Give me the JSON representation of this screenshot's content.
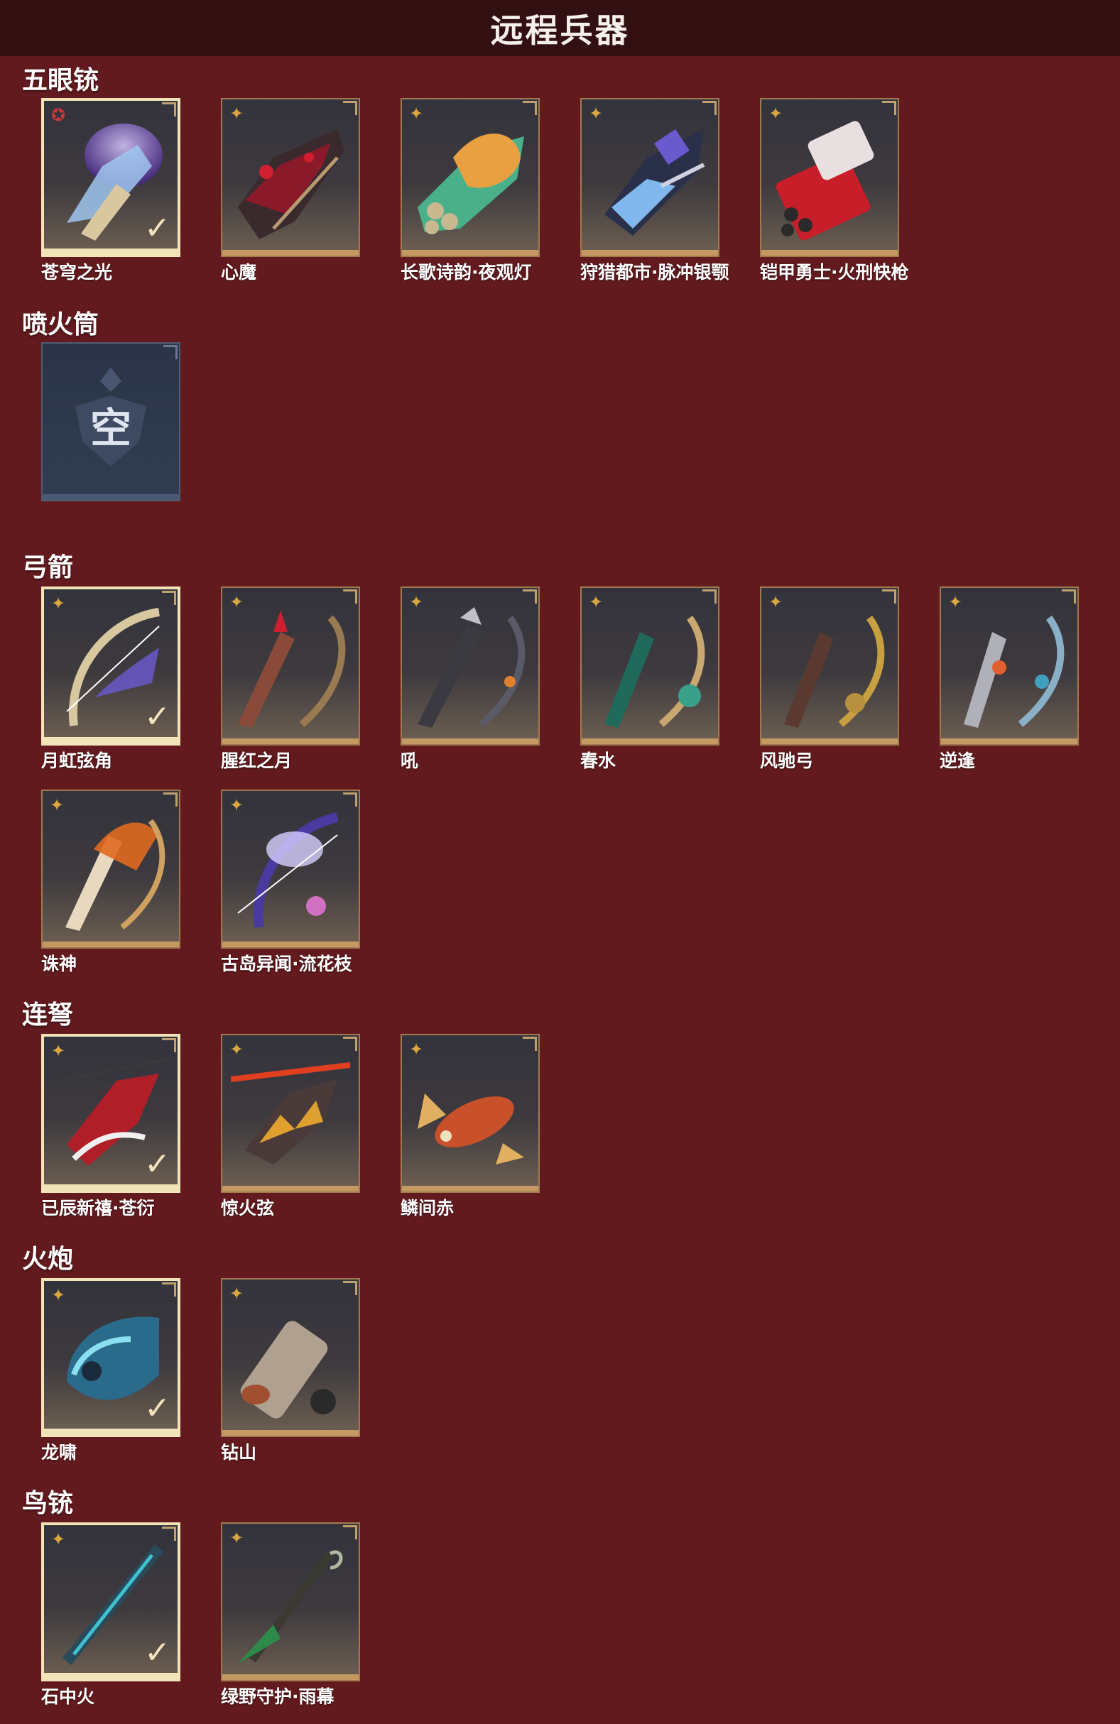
{
  "header": {
    "title": "远程兵器"
  },
  "sections": [
    {
      "title": "五眼铳",
      "items": [
        "苍穹之光",
        "心魔",
        "长歌诗韵·夜观灯",
        "狩猎都市·脉冲银颚",
        "铠甲勇士·火刑快枪"
      ]
    },
    {
      "title": "喷火筒",
      "empty_label": "空"
    },
    {
      "title": "弓箭",
      "items": [
        "月虹弦角",
        "腥红之月",
        "吼",
        "春水",
        "风驰弓",
        "逆逢",
        "诛神",
        "古岛异闻·流花枝"
      ]
    },
    {
      "title": "连弩",
      "items": [
        "已辰新禧·苍衍",
        "惊火弦",
        "鳞间赤"
      ]
    },
    {
      "title": "火炮",
      "items": [
        "龙啸",
        "钻山"
      ]
    },
    {
      "title": "鸟铳",
      "items": [
        "石中火",
        "绿野守护·雨幕"
      ]
    }
  ],
  "icons": {
    "rarity": "star-badge-icon",
    "equipped": "checkmark-icon",
    "corner": "corner-tab-icon"
  },
  "colors": {
    "background": "#621a1e",
    "header": "#321012",
    "card_border": "#a07a4e",
    "selected_border": "#f3e3b8",
    "rarity_gold": "#d9a640",
    "rarity_red": "#c83a3a"
  }
}
